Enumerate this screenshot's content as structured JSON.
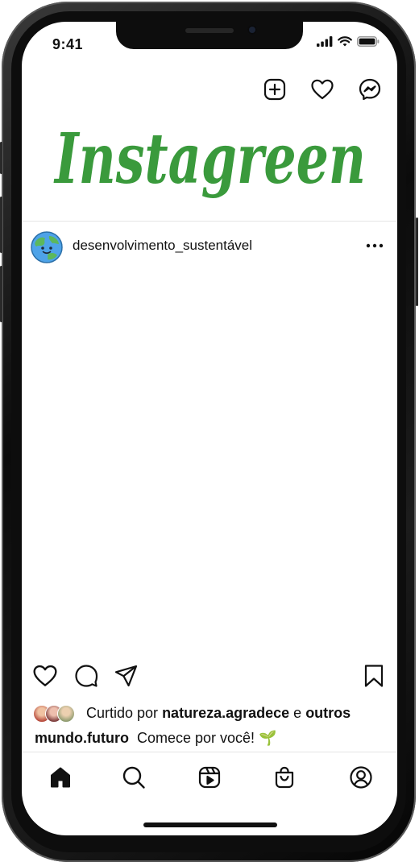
{
  "status_bar": {
    "time": "9:41"
  },
  "header": {
    "logo_text": "Instagreen",
    "logo_color": "#3a9a3c",
    "icons": [
      "new-post-icon",
      "heart-icon",
      "messenger-icon"
    ]
  },
  "post": {
    "username": "desenvolvimento_sustentável",
    "liked_by_prefix": "Curtido por",
    "liked_by_user": "natureza.agradece",
    "liked_by_joiner": "e",
    "liked_by_others": "outros",
    "caption_user": "mundo.futuro",
    "caption_text": "Comece por você! 🌱"
  },
  "bottom_nav": {
    "items": [
      "home-icon",
      "search-icon",
      "reels-icon",
      "shop-icon",
      "profile-icon"
    ]
  }
}
